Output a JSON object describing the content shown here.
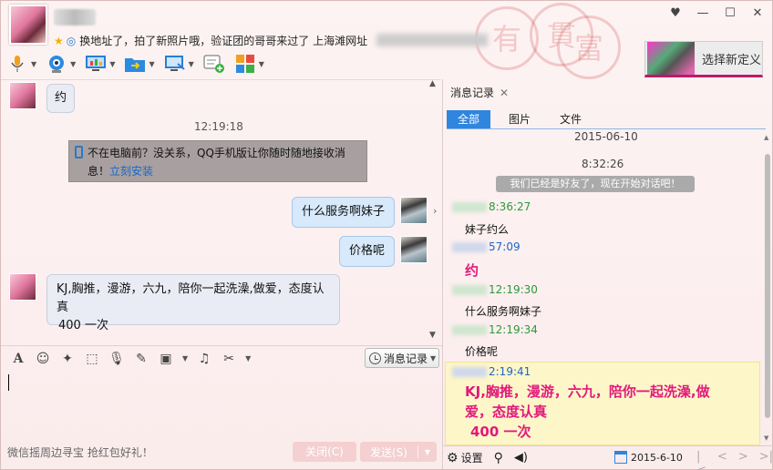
{
  "titlebar": {
    "signature": "换地址了，拍了新照片哦，验证团的哥哥来过了 上海滩网址",
    "buttons": [
      "minimize",
      "restore",
      "maximize",
      "close"
    ]
  },
  "skin": {
    "label": "选择新定义"
  },
  "toolbar": {
    "items": [
      "microphone-icon",
      "webcam-icon",
      "screen-share-icon",
      "file-transfer-icon",
      "remote-desktop-icon",
      "chat-add-icon",
      "apps-icon"
    ]
  },
  "chat": {
    "msg1": "约",
    "time1": "12:19:18",
    "notice_text": "不在电脑前？没关系，QQ手机版让你随时随地接收消息！",
    "notice_link": "立刻安装",
    "msg2": "什么服务啊妹子",
    "msg3": "价格呢",
    "msg4_line1": "KJ,胸推，漫游，六九，陪你一起洗澡,做爱，态度认真",
    "msg4_line2": "400 一次"
  },
  "input": {
    "history_label": "消息记录",
    "promo": "微信摇周边寻宝 抢红包好礼！",
    "close_label": "关闭(C)",
    "send_label": "发送(S)"
  },
  "panel": {
    "title": "消息记录",
    "tabs": [
      "全部",
      "图片",
      "文件"
    ],
    "date": "2015-06-10",
    "time_head": "8:32:26",
    "system_msg": "我们已经是好友了，现在开始对话吧！",
    "entries": [
      {
        "time": "8:36:27",
        "text": "妹子约么"
      },
      {
        "time": "57:09",
        "text": "约"
      },
      {
        "time": "12:19:30",
        "text": "什么服务啊妹子"
      },
      {
        "time": "12:19:34",
        "text": "价格呢"
      },
      {
        "time": "2:19:41"
      }
    ],
    "long_msg_line1": "KJ,胸推，漫游，六九，陪你一起洗澡,做",
    "long_msg_line2": "爱，态度认真",
    "long_msg_line3": "400 一次",
    "settings_label": "设置",
    "date_filter": "2015-6-10"
  }
}
